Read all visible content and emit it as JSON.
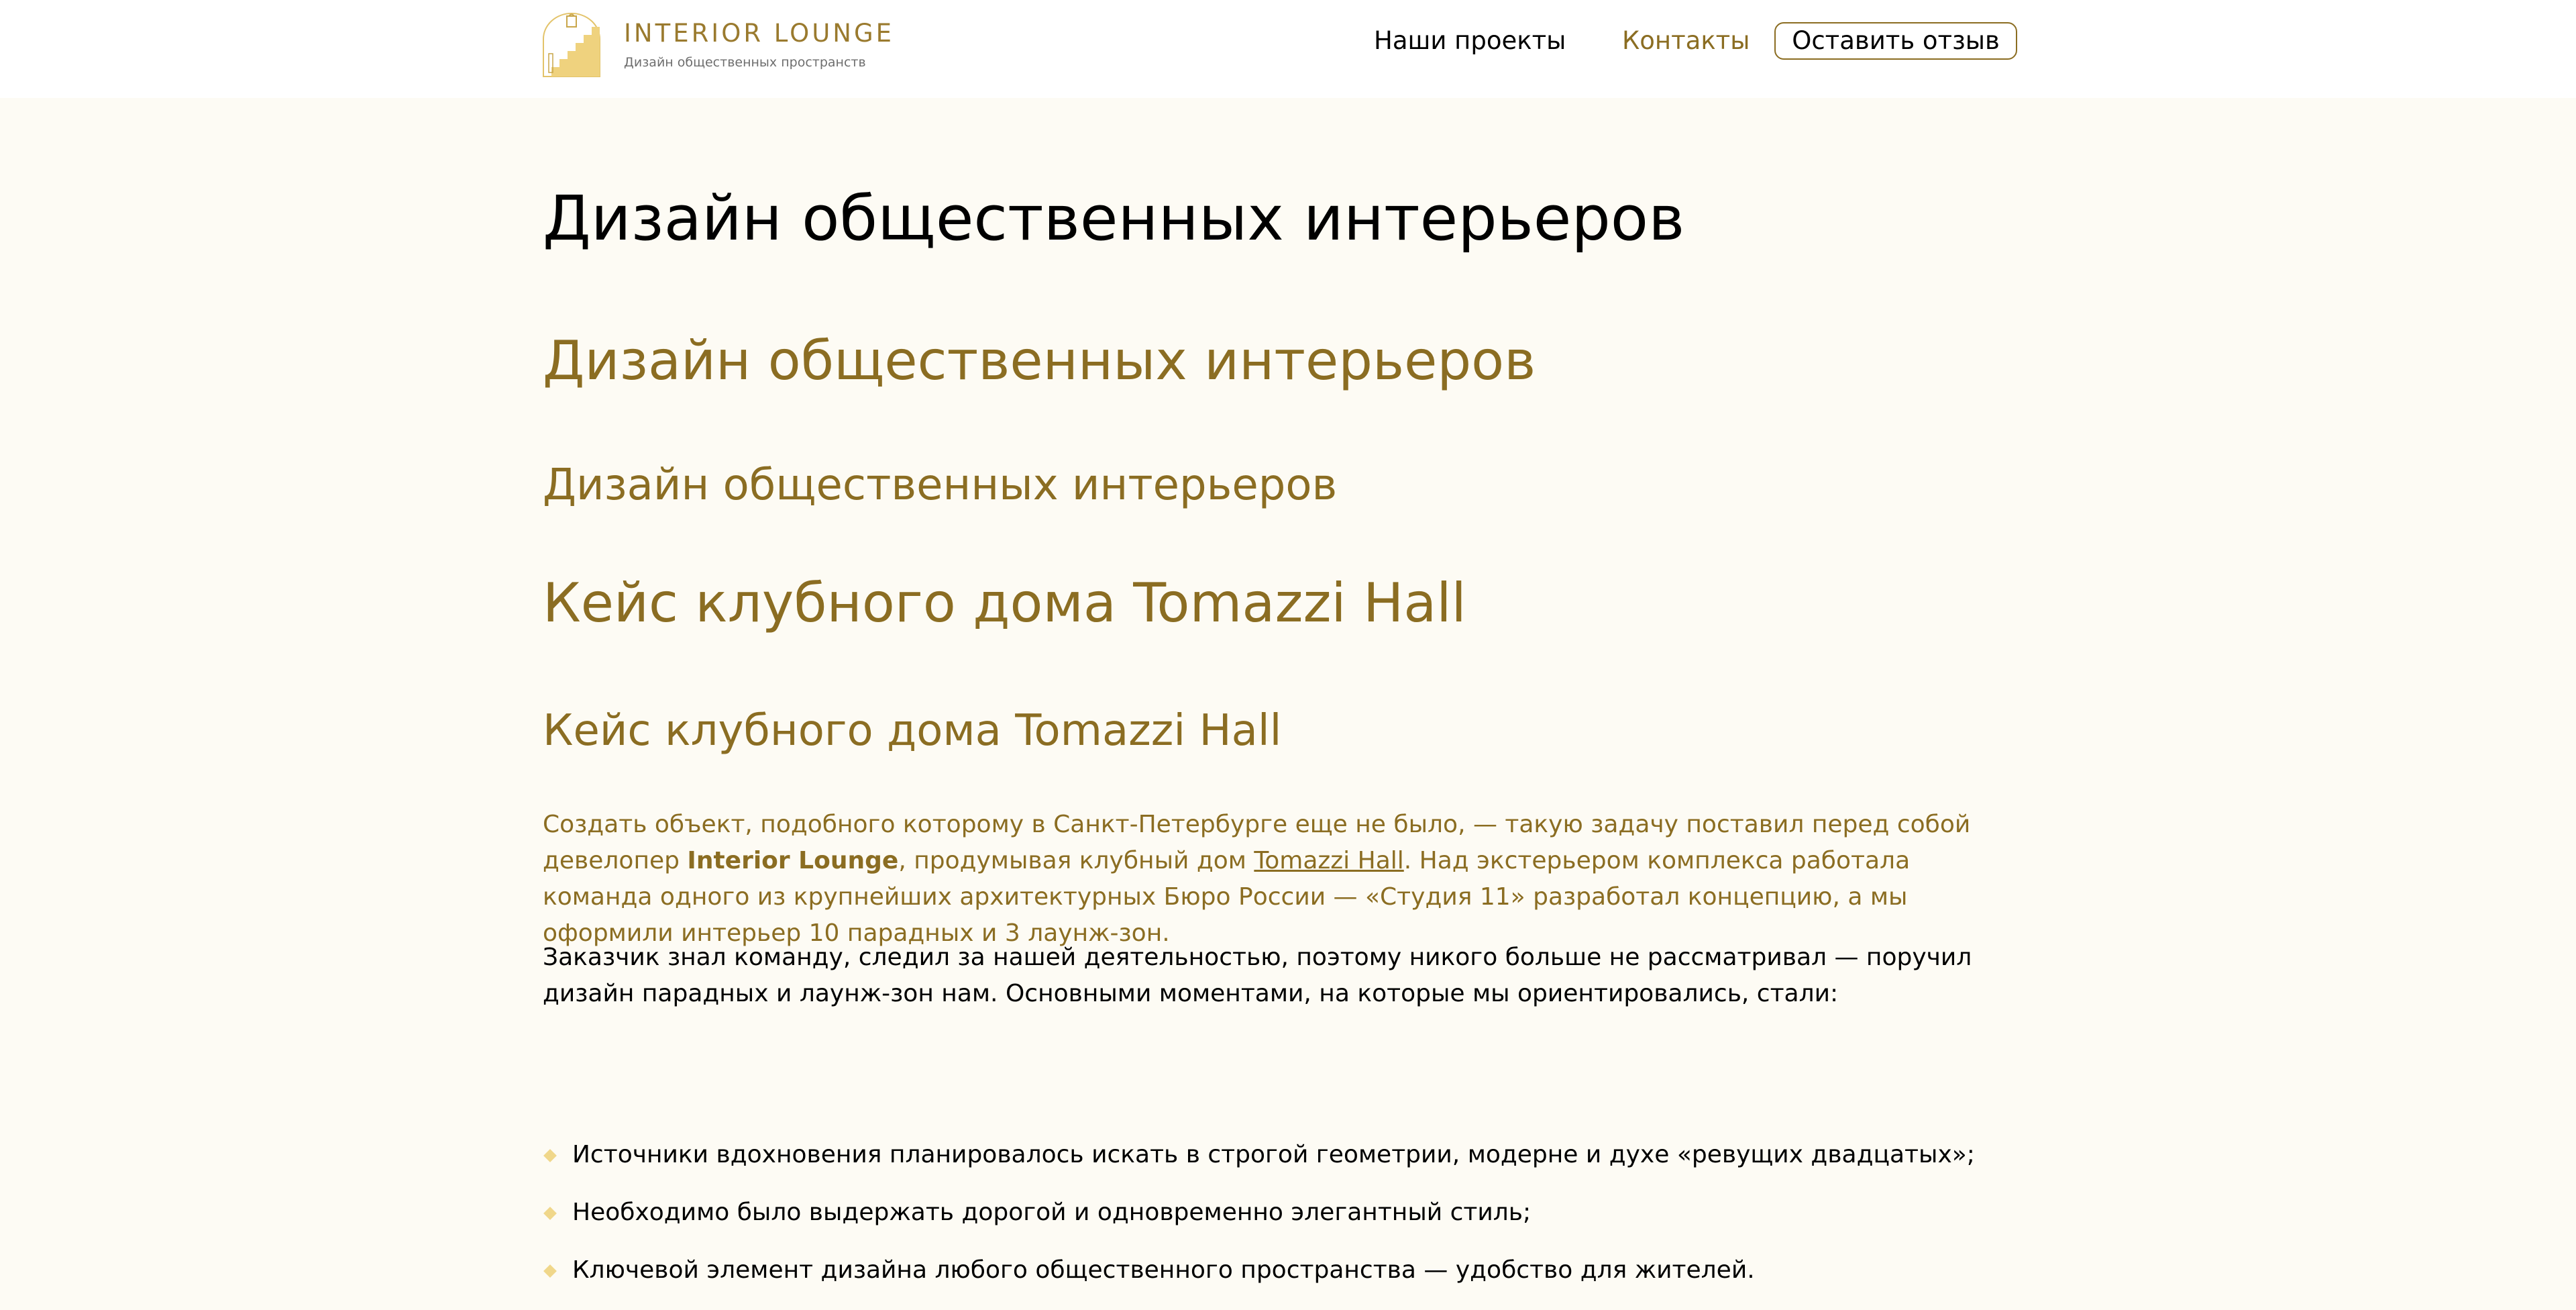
{
  "header": {
    "logo_name": "INTERIOR LOUNGE",
    "logo_tagline": "Дизайн общественных пространств",
    "nav": [
      {
        "label": "Наши проекты"
      },
      {
        "label": "Контакты"
      }
    ],
    "review_button": "Оставить отзыв"
  },
  "main": {
    "title": "Дизайн общественных интерьеров",
    "heading_2": "Дизайн общественных интерьеров",
    "heading_3": "Дизайн общественных интерьеров",
    "case_heading_large": "Кейс клубного дома Tomazzi Hall",
    "case_heading_small": "Кейс клубного дома Tomazzi Hall",
    "intro": {
      "part1": "Создать объект, подобного которому в Санкт-Петербурге еще не было, — такую задачу поставил перед собой девелопер ",
      "bold": "Interior Lounge",
      "part2": ", продумывая клубный дом ",
      "link": "Tomazzi Hall",
      "part3": ". Над экстерьером комплекса работала команда одного из крупнейших архитектурных Бюро России — «Студия 11» разработал концепцию, а мы оформили интерьер 10 парадных и 3 лаунж-зон."
    },
    "paragraph": "Заказчик знал команду, следил за нашей деятельностью, поэтому никого больше не рассматривал — поручил дизайн парадных и лаунж-зон нам. Основными моментами, на которые мы ориентировались, стали:",
    "list": [
      "Источники вдохновения планировалось искать в строгой геометрии, модерне и духе «ревущих двадцатых»;",
      "Необходимо было выдержать дорогой и одновременно элегантный стиль;",
      "Ключевой элемент дизайна любого общественного пространства — удобство для жителей."
    ]
  },
  "colors": {
    "accent": "#8b6d22",
    "logo_gold": "#e3c36a",
    "bullet": "#f0d78a",
    "page_background": "#fdfbf4",
    "header_background": "#ffffff"
  },
  "icons": {
    "logo": "arched-doorway-stairs-logo-icon",
    "bullet": "diamond-bullet-icon"
  }
}
